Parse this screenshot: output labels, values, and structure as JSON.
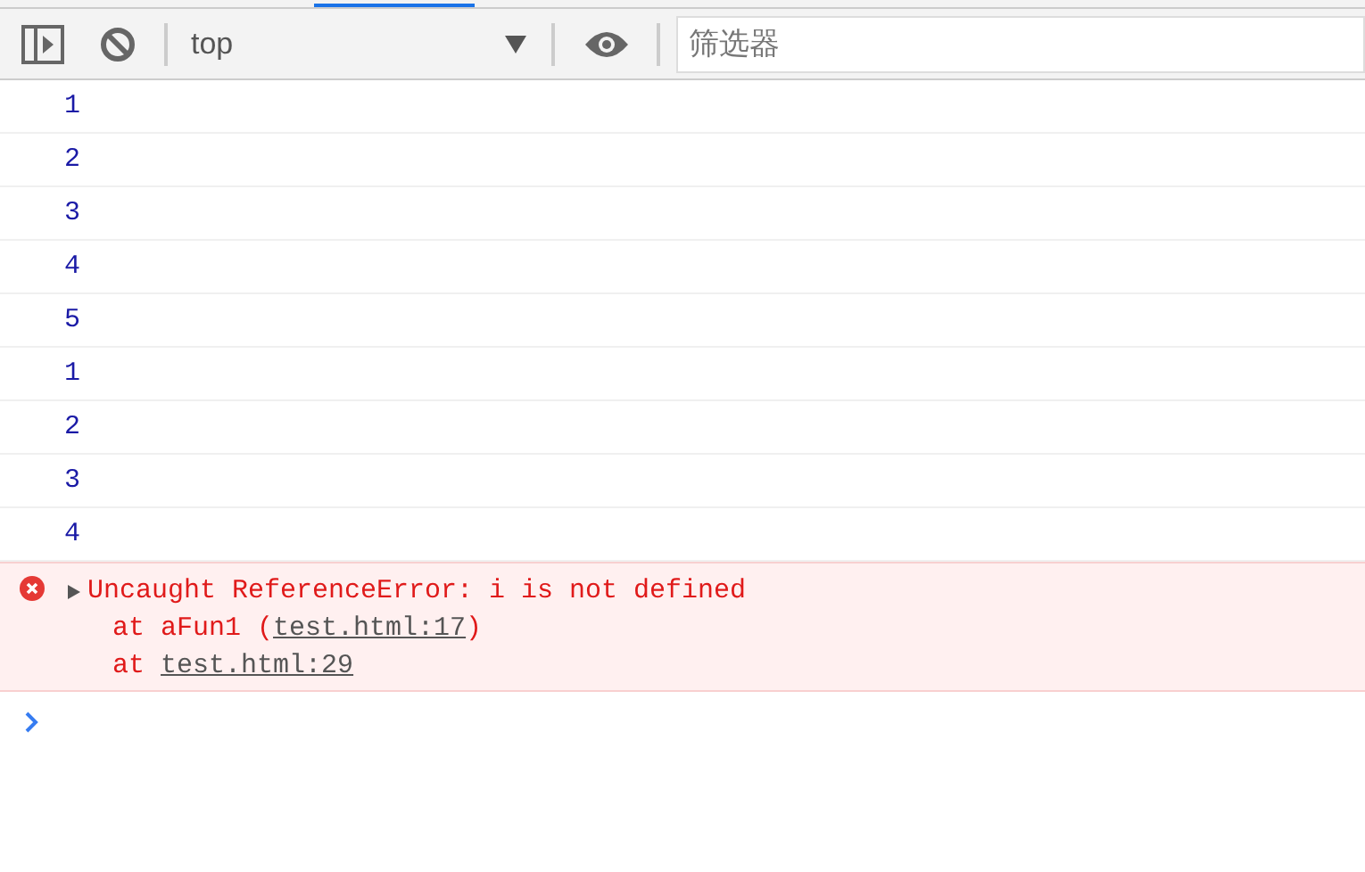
{
  "toolbar": {
    "context": "top",
    "filter": {
      "placeholder": "筛选器"
    }
  },
  "messages": [
    {
      "kind": "number",
      "text": "1"
    },
    {
      "kind": "number",
      "text": "2"
    },
    {
      "kind": "number",
      "text": "3"
    },
    {
      "kind": "number",
      "text": "4"
    },
    {
      "kind": "number",
      "text": "5"
    },
    {
      "kind": "number",
      "text": "1"
    },
    {
      "kind": "number",
      "text": "2"
    },
    {
      "kind": "number",
      "text": "3"
    },
    {
      "kind": "number",
      "text": "4"
    },
    {
      "kind": "error",
      "expanded": false,
      "text": "Uncaught ReferenceError: i is not defined",
      "stack": [
        {
          "prefix": "at aFun1 (",
          "link": "test.html:17",
          "suffix": ")"
        },
        {
          "prefix": "at ",
          "link": "test.html:29"
        }
      ]
    }
  ]
}
